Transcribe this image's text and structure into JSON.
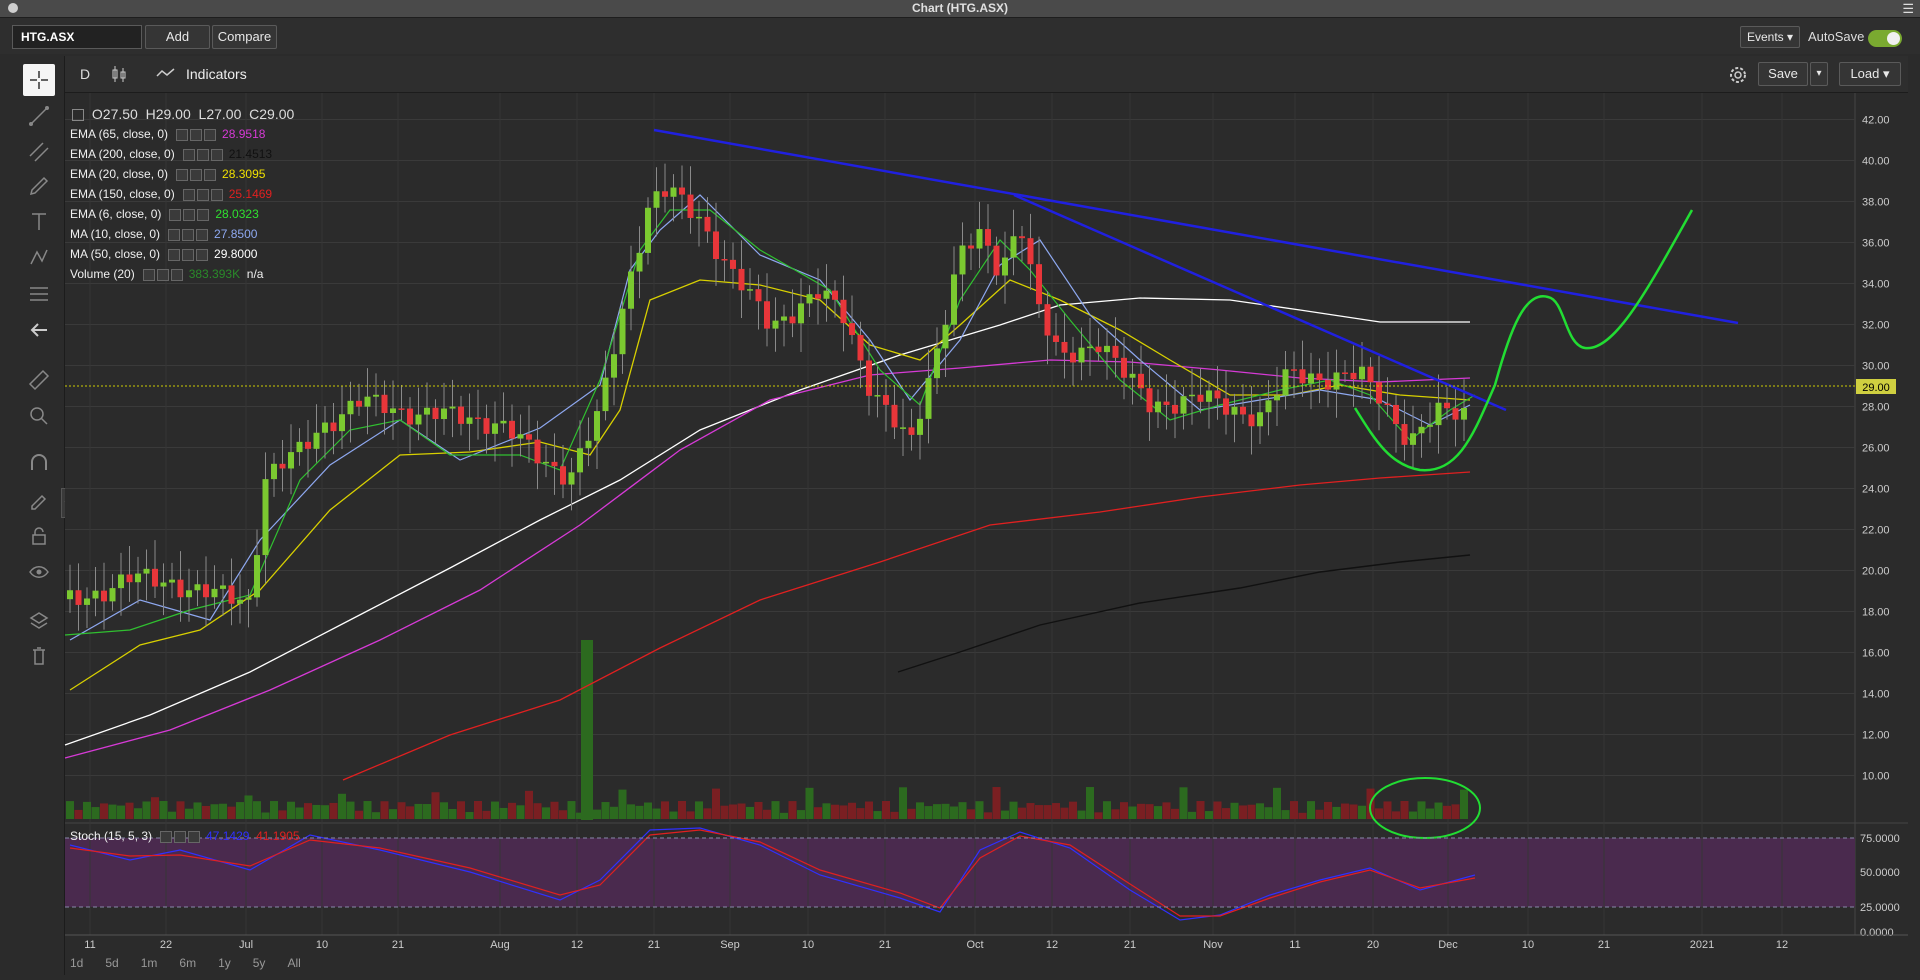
{
  "window": {
    "title": "Chart (HTG.ASX)"
  },
  "toolbar": {
    "symbol": "HTG.ASX",
    "add_label": "Add",
    "compare_label": "Compare",
    "events_label": "Events",
    "autosave_label": "AutoSave",
    "autosave_on": true
  },
  "chart_toolbar": {
    "period": "D",
    "indicators_label": "Indicators",
    "save_label": "Save",
    "load_label": "Load"
  },
  "ohlc": {
    "open": "O27.50",
    "high": "H29.00",
    "low": "L27.00",
    "close": "C29.00"
  },
  "indicators": [
    {
      "label": "EMA (65, close, 0)",
      "value": "28.9518",
      "color": "#d63ad6"
    },
    {
      "label": "EMA (200, close, 0)",
      "value": "21.4513",
      "color": "#111111"
    },
    {
      "label": "EMA (20, close, 0)",
      "value": "28.3095",
      "color": "#f0e000"
    },
    {
      "label": "EMA (150, close, 0)",
      "value": "25.1469",
      "color": "#e02020"
    },
    {
      "label": "EMA (6, close, 0)",
      "value": "28.0323",
      "color": "#30e030"
    },
    {
      "label": "MA (10, close, 0)",
      "value": "27.8500",
      "color": "#8ea8f0"
    },
    {
      "label": "MA (50, close, 0)",
      "value": "29.8000",
      "color": "#ffffff"
    },
    {
      "label": "Volume (20)",
      "value": "383.393K",
      "value2": "n/a",
      "color": "#2a8a2a"
    }
  ],
  "price_axis": [
    "42.00",
    "40.00",
    "38.00",
    "36.00",
    "34.00",
    "32.00",
    "30.00",
    "28.00",
    "26.00",
    "24.00",
    "22.00",
    "20.00",
    "18.00",
    "16.00",
    "14.00",
    "12.00",
    "10.00"
  ],
  "current_price": "29.00",
  "stoch": {
    "label": "Stoch (15, 5, 3)",
    "k": "47.1429",
    "d": "41.1905",
    "axis": [
      "75.0000",
      "50.0000",
      "25.0000",
      "0.0000"
    ]
  },
  "date_axis": [
    "11",
    "22",
    "Jul",
    "10",
    "21",
    "Aug",
    "12",
    "21",
    "Sep",
    "10",
    "21",
    "Oct",
    "12",
    "21",
    "Nov",
    "11",
    "20",
    "Dec",
    "10",
    "21",
    "2021",
    "12"
  ],
  "ranges": [
    "1d",
    "5d",
    "1m",
    "6m",
    "1y",
    "5y",
    "All"
  ],
  "colors": {
    "up": "#7bc930",
    "down": "#e8363a",
    "bg": "#2b2b2b",
    "trendline": "#2020e0",
    "annotation": "#22dd33"
  }
}
